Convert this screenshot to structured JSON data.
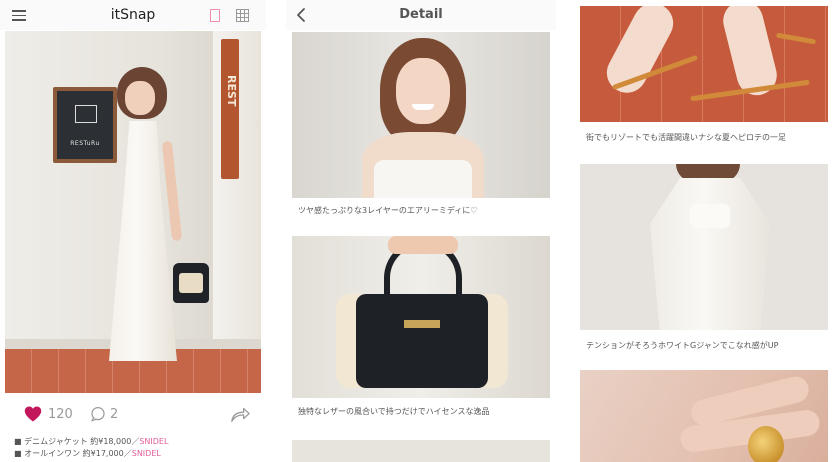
{
  "feed": {
    "app_title": "itSnap",
    "menu_icon": "hamburger-menu-icon",
    "view_toggle": {
      "single_icon": "single-view-icon",
      "grid_icon": "grid-view-icon",
      "active": "single",
      "active_color": "#f08db0"
    },
    "photo": {
      "board_text": "RESTuRu",
      "sign_text": "REST"
    },
    "likes": "120",
    "comments": "2",
    "heart_color": "#c2185b",
    "items": [
      {
        "text": "■ デニムジャケット 約¥18,000／",
        "brand": "SNIDEL"
      },
      {
        "text": "■ オールインワン 約¥17,000／",
        "brand": "SNIDEL"
      }
    ],
    "brand_color": "#e0609a"
  },
  "detail": {
    "title": "Detail",
    "back_icon": "chevron-left-icon",
    "captions": [
      "ツヤ感たっぷりな3レイヤーのエアリーミディに♡",
      "独特なレザーの風合いで持つだけでハイセンスな逸品"
    ]
  },
  "gallery": {
    "captions": [
      "街でもリゾートでも活躍間違いナシな夏ヘピロテの一足",
      "テンションがそろうホワイトGジャンでこなれ感がUP"
    ]
  }
}
